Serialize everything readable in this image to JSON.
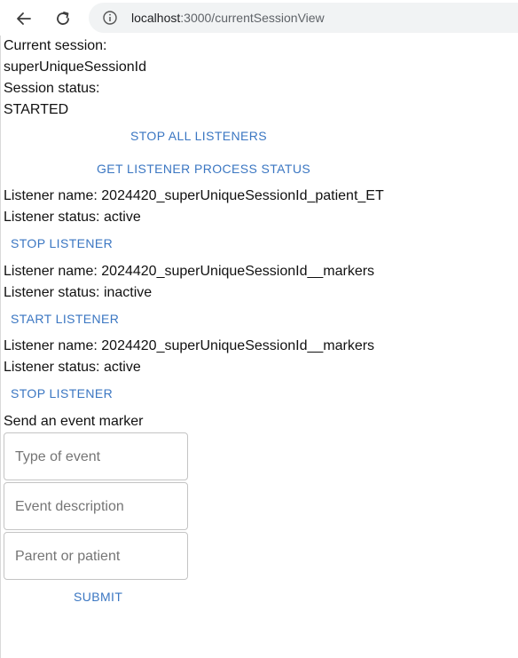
{
  "browser": {
    "url_host": "localhost",
    "url_path": ":3000/currentSessionView"
  },
  "session": {
    "current_label": "Current session:",
    "id": "superUniqueSessionId",
    "status_label": "Session status:",
    "status": "STARTED"
  },
  "actions": {
    "stop_all": "STOP ALL LISTENERS",
    "get_status": "GET LISTENER PROCESS STATUS"
  },
  "listeners": [
    {
      "name": "Listener name: 2024420_superUniqueSessionId_patient_ET",
      "status": "Listener status: active",
      "button": "STOP LISTENER"
    },
    {
      "name": "Listener name: 2024420_superUniqueSessionId__markers",
      "status": "Listener status: inactive",
      "button": "START LISTENER"
    },
    {
      "name": "Listener name: 2024420_superUniqueSessionId__markers",
      "status": "Listener status: active",
      "button": "STOP LISTENER"
    }
  ],
  "marker_form": {
    "heading": "Send an event marker",
    "type_placeholder": "Type of event",
    "description_placeholder": "Event description",
    "party_placeholder": "Parent or patient",
    "submit": "SUBMIT"
  }
}
